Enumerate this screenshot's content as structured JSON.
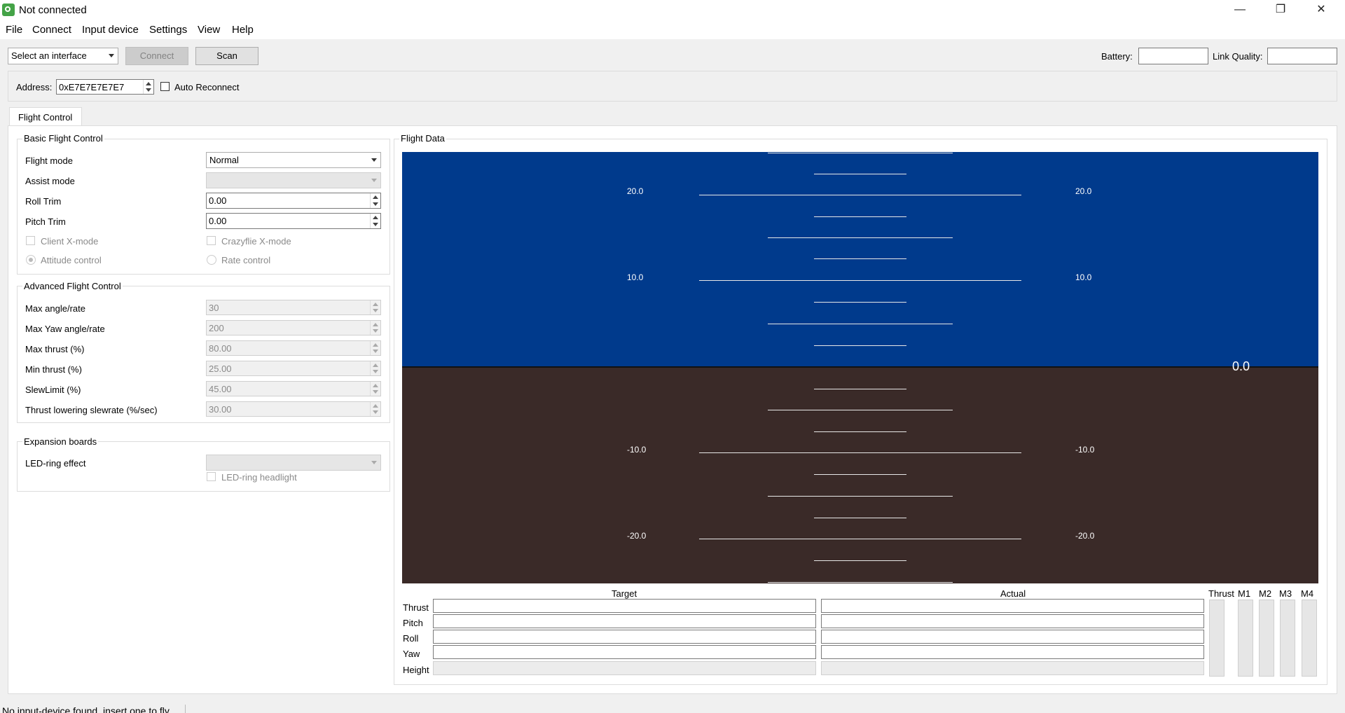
{
  "window": {
    "title": "Not connected",
    "minimize": "—",
    "maximize": "❐",
    "close": "✕"
  },
  "menu": [
    "File",
    "Connect",
    "Input device",
    "Settings",
    "View",
    "Help"
  ],
  "toolbar": {
    "interface": "Select an interface",
    "connect": "Connect",
    "scan": "Scan",
    "battery_label": "Battery:",
    "link_label": "Link Quality:"
  },
  "address": {
    "label": "Address:",
    "value": "0xE7E7E7E7E7",
    "auto_reconnect": "Auto Reconnect"
  },
  "tabs": [
    "Flight Control"
  ],
  "basic": {
    "title": "Basic Flight Control",
    "flight_mode_label": "Flight mode",
    "flight_mode_value": "Normal",
    "assist_mode_label": "Assist mode",
    "roll_trim_label": "Roll Trim",
    "roll_trim_value": "0.00",
    "pitch_trim_label": "Pitch Trim",
    "pitch_trim_value": "0.00",
    "client_xmode": "Client X-mode",
    "crazyflie_xmode": "Crazyflie X-mode",
    "attitude": "Attitude control",
    "rate": "Rate control"
  },
  "advanced": {
    "title": "Advanced Flight Control",
    "rows": [
      {
        "label": "Max angle/rate",
        "value": "30"
      },
      {
        "label": "Max Yaw angle/rate",
        "value": "200"
      },
      {
        "label": "Max thrust (%)",
        "value": "80.00"
      },
      {
        "label": "Min thrust (%)",
        "value": "25.00"
      },
      {
        "label": "SlewLimit (%)",
        "value": "45.00"
      },
      {
        "label": "Thrust lowering slewrate (%/sec)",
        "value": "30.00"
      }
    ]
  },
  "expansion": {
    "title": "Expansion boards",
    "led_effect": "LED-ring effect",
    "led_headlight": "LED-ring headlight"
  },
  "flight_data": {
    "title": "Flight Data",
    "pitch_labels": [
      "20.0",
      "10.0",
      "-10.0",
      "-20.0"
    ],
    "altitude": "0.0",
    "target": "Target",
    "actual": "Actual",
    "rows": [
      "Thrust",
      "Pitch",
      "Roll",
      "Yaw",
      "Height"
    ],
    "motors": [
      "Thrust",
      "M1",
      "M2",
      "M3",
      "M4"
    ]
  },
  "colors": {
    "sky": "#003a8c",
    "ground": "#3a2a28"
  },
  "status": "No input-device found, insert one to fly."
}
